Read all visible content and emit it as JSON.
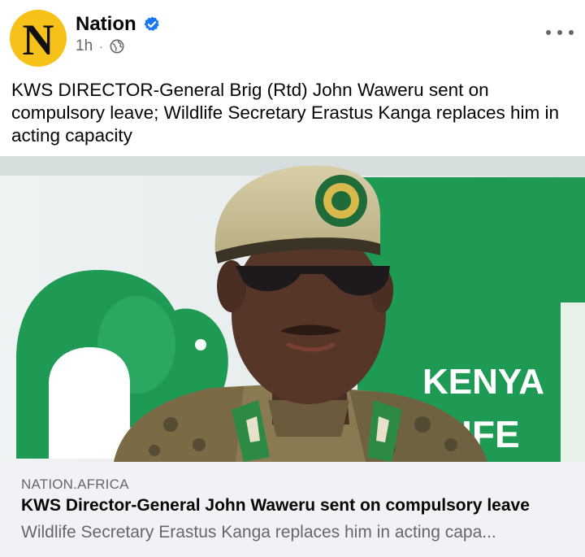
{
  "post": {
    "page_name": "Nation",
    "avatar_letter": "N",
    "verified_icon": "verified-badge-icon",
    "time": "1h",
    "separator": "·",
    "audience_icon": "globe-icon",
    "more_icon": "more-options-icon",
    "text": "KWS DIRECTOR-General Brig (Rtd) John Waweru sent on compulsory leave; Wildlife Secretary Erastus Kanga replaces him in acting capacity"
  },
  "link_preview": {
    "domain": "NATION.AFRICA",
    "title": "KWS Director-General John Waweru sent on compulsory leave",
    "description": "Wildlife Secretary Erastus Kanga replaces him in acting capa...",
    "image": {
      "banner_text_1": "KENYA",
      "banner_text_2": "LIFE"
    }
  },
  "colors": {
    "avatar_bg": "#f6c21a",
    "verified_blue": "#1877f2",
    "kws_green": "#1f9a55",
    "secondary_text": "#65676b",
    "preview_bg": "#f0f2f5"
  }
}
